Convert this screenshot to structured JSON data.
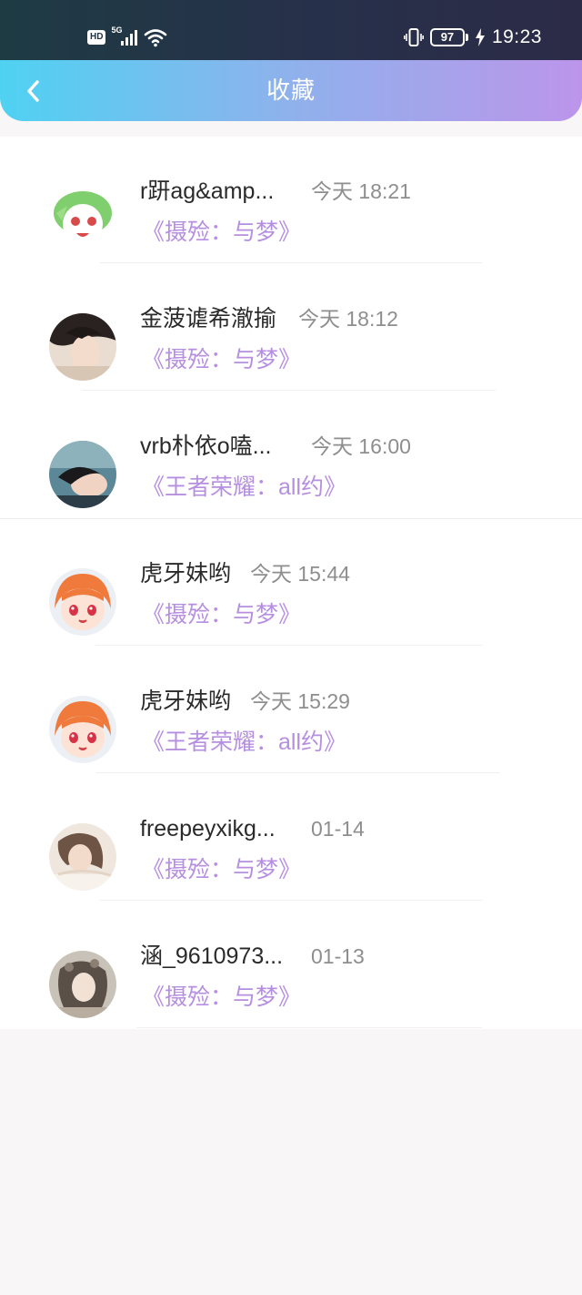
{
  "status_bar": {
    "hd": "HD",
    "network": "5G",
    "battery": "97",
    "time": "19:23"
  },
  "header": {
    "title": "收藏",
    "back_icon": "chevron-left-icon"
  },
  "favorites": [
    {
      "name": "r趼ag&amp...",
      "time": "今天 18:21",
      "tag": "《摄殓：与梦》"
    },
    {
      "name": "金菠谑希澈揄",
      "time": "今天 18:12",
      "tag": "《摄殓：与梦》"
    },
    {
      "name": "vrb朴依o嗑...",
      "time": "今天 16:00",
      "tag": "《王者荣耀：all约》"
    },
    {
      "name": "虎牙妹哟",
      "time": "今天 15:44",
      "tag": "《摄殓：与梦》"
    },
    {
      "name": "虎牙妹哟",
      "time": "今天 15:29",
      "tag": "《王者荣耀：all约》"
    },
    {
      "name": "freepeyxikg...",
      "time": "01-14",
      "tag": "《摄殓：与梦》"
    },
    {
      "name": "涵_9610973...",
      "time": "01-13",
      "tag": "《摄殓：与梦》"
    }
  ]
}
